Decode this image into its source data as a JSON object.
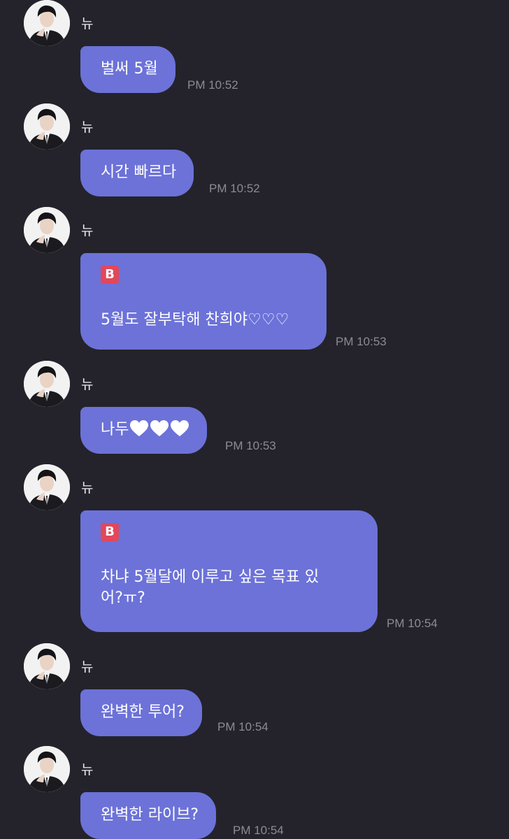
{
  "messages": [
    {
      "sender": "뉴",
      "text": "벌써 5월",
      "time": "PM 10:52",
      "badge": ""
    },
    {
      "sender": "뉴",
      "text": "시간 빠르다",
      "time": "PM 10:52",
      "badge": ""
    },
    {
      "sender": "뉴",
      "text": "5월도 잘부탁해 찬희야♡♡♡",
      "time": "PM 10:53",
      "badge": "B"
    },
    {
      "sender": "뉴",
      "text": "나두",
      "time": "PM 10:53",
      "badge": "",
      "emoji": "white-heart-icon x3"
    },
    {
      "sender": "뉴",
      "text": "차냐 5월달에 이루고 싶은 목표 있\n어?ㅠ?",
      "time": "PM 10:54",
      "badge": "B"
    },
    {
      "sender": "뉴",
      "text": "완벽한 투어?",
      "time": "PM 10:54",
      "badge": ""
    },
    {
      "sender": "뉴",
      "text": "완벽한 라이브?",
      "time": "PM 10:54",
      "badge": ""
    }
  ],
  "colors": {
    "background": "#24232b",
    "bubble": "#6c72d8",
    "timestamp": "#8b8b94",
    "badge": "#e2475a"
  }
}
